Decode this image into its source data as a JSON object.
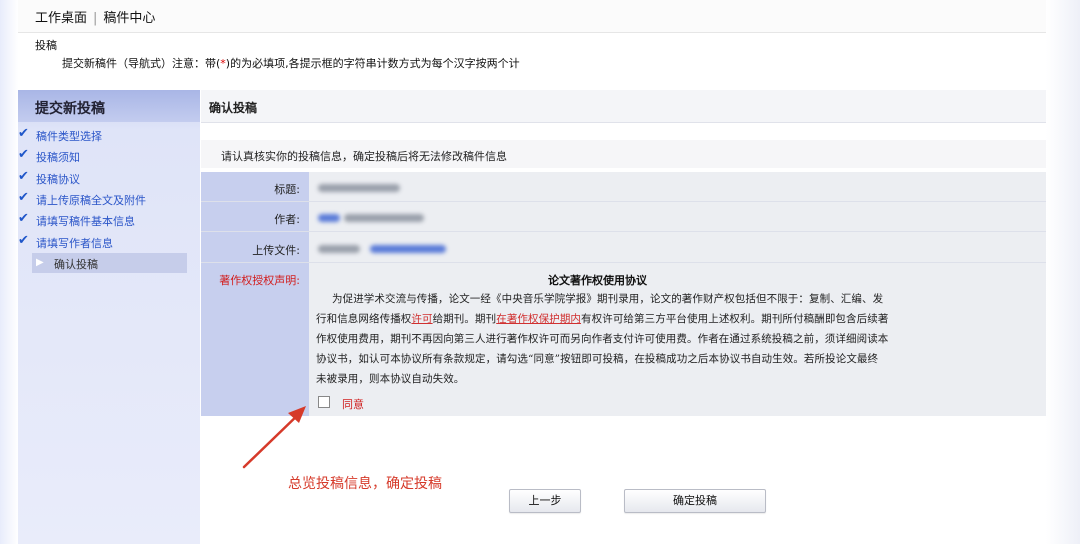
{
  "header": {
    "breadcrumb": [
      "工作桌面",
      "稿件中心"
    ],
    "section_title": "投稿",
    "notice_prefix": "提交新稿件（导航式）注意：带(",
    "notice_star": "*",
    "notice_suffix": ")的为必填项,各提示框的字符串计数方式为每个汉字按两个计"
  },
  "sidebar": {
    "title": "提交新投稿",
    "steps": [
      {
        "label": "稿件类型选择",
        "done": true
      },
      {
        "label": "投稿须知",
        "done": true
      },
      {
        "label": "投稿协议",
        "done": true
      },
      {
        "label": "请上传原稿全文及附件",
        "done": true
      },
      {
        "label": "请填写稿件基本信息",
        "done": true
      },
      {
        "label": "请填写作者信息",
        "done": true
      },
      {
        "label": "确认投稿",
        "done": false
      }
    ]
  },
  "main": {
    "title": "确认投稿",
    "notice": "请认真核实你的投稿信息，确定投稿后将无法修改稿件信息",
    "fields": {
      "title_label": "标题:",
      "author_label": "作者:",
      "upload_label": "上传文件:",
      "copyright_label": "著作权授权声明:"
    },
    "agreement": {
      "title": "论文著作权使用协议",
      "line1": "为促进学术交流与传播，论文一经《中央音乐学院学报》期刊录用，论文的著作财产权包括但不限于：复制、汇编、发",
      "line2_a": "行和信息网络传播权",
      "line2_link1": "许可",
      "line2_b": "给期刊。期刊",
      "line2_link2": "在著作权保护期内",
      "line2_c": "有权许可给第三方平台使用上述权利。期刊所付稿酬即包含后续著",
      "line3": "作权使用费用，期刊不再因向第三人进行著作权许可而另向作者支付许可使用费。作者在通过系统投稿之前，须详细阅读本",
      "line4": "协议书，如认可本协议所有条款规定，请勾选“同意”按钮即可投稿，在投稿成功之后本协议书自动生效。若所投论文最终",
      "line5": "未被录用，则本协议自动失效。",
      "agree_label": "同意"
    },
    "annotation": "总览投稿信息，确定投稿",
    "buttons": {
      "prev": "上一步",
      "submit": "确定投稿"
    }
  },
  "colors": {
    "accent_red": "#d63a2a",
    "sidebar_blue": "#c7cfee",
    "step_link": "#2a55c8"
  }
}
